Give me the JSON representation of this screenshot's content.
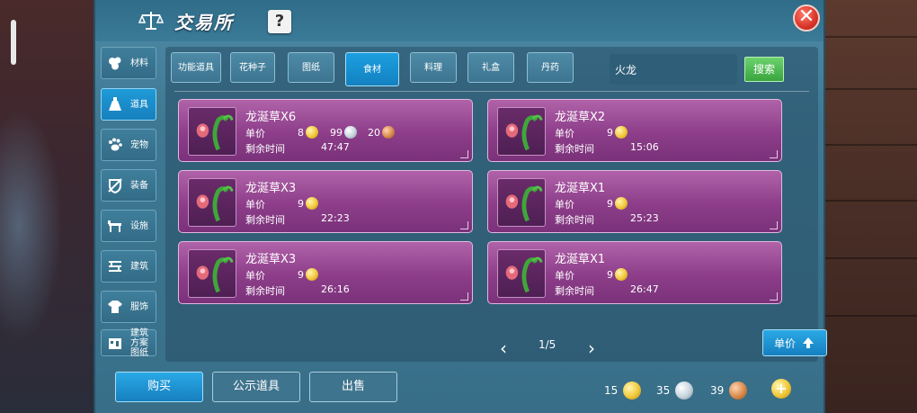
{
  "window": {
    "title": "交易所",
    "help": "?",
    "close": "✕"
  },
  "sidebar": {
    "items": [
      {
        "label": "材料",
        "icon": "materials-icon"
      },
      {
        "label": "道具",
        "icon": "potion-icon",
        "active": true
      },
      {
        "label": "宠物",
        "icon": "paw-icon"
      },
      {
        "label": "装备",
        "icon": "armor-icon"
      },
      {
        "label": "设施",
        "icon": "facility-icon"
      },
      {
        "label": "建筑",
        "icon": "building-icon"
      },
      {
        "label": "服饰",
        "icon": "clothing-icon"
      },
      {
        "label": "建筑方案图纸",
        "icon": "blueprint-icon"
      }
    ]
  },
  "tabs": [
    {
      "label": "功能道具"
    },
    {
      "label": "花种子"
    },
    {
      "label": "图纸"
    },
    {
      "label": "食材",
      "active": true
    },
    {
      "label": "料理"
    },
    {
      "label": "礼盒"
    },
    {
      "label": "丹药"
    }
  ],
  "search": {
    "value": "火龙",
    "button": "搜索"
  },
  "listing_labels": {
    "price": "单价",
    "time_left": "剩余时间"
  },
  "listings": [
    {
      "name": "龙涎草X6",
      "price_gold": "8",
      "price_silver": "99",
      "price_copper": "20",
      "time": "47:47"
    },
    {
      "name": "龙涎草X2",
      "price_gold": "9",
      "time": "15:06"
    },
    {
      "name": "龙涎草X3",
      "price_gold": "9",
      "time": "22:23"
    },
    {
      "name": "龙涎草X1",
      "price_gold": "9",
      "time": "25:23"
    },
    {
      "name": "龙涎草X3",
      "price_gold": "9",
      "time": "26:16"
    },
    {
      "name": "龙涎草X1",
      "price_gold": "9",
      "time": "26:47"
    }
  ],
  "pagination": {
    "text": "1/5",
    "prev": "‹",
    "next": "›"
  },
  "sort": {
    "label": "单价"
  },
  "bottom": {
    "buy": "购买",
    "public": "公示道具",
    "sell": "出售"
  },
  "currency": {
    "gold": "15",
    "silver": "35",
    "copper": "39",
    "add": "+"
  },
  "colors": {
    "accent": "#1c9fe0",
    "card": "#8d3d89",
    "search": "#3aa53f",
    "close": "#d8342a"
  }
}
